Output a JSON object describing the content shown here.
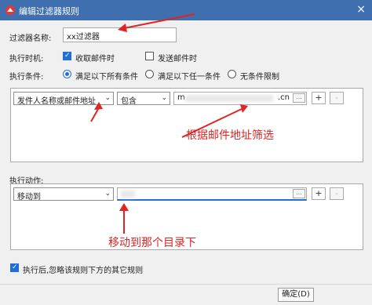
{
  "window": {
    "title": "编辑过滤器规则",
    "close_glyph": "×"
  },
  "form": {
    "name_label": "过滤器名称:",
    "name_value": "xx过滤器",
    "time_label": "执行时机:",
    "time_options": [
      {
        "label": "收取邮件时",
        "checked": true
      },
      {
        "label": "发送邮件时",
        "checked": false
      }
    ],
    "cond_label": "执行条件:",
    "cond_options": [
      {
        "label": "满足以下所有条件",
        "selected": true
      },
      {
        "label": "满足以下任一条件",
        "selected": false
      },
      {
        "label": "无条件限制",
        "selected": false
      }
    ]
  },
  "condition": {
    "field": "发件人名称或邮件地址",
    "operator": "包含",
    "value_prefix": "m",
    "value_suffix": ".cn",
    "ellipsis": "...",
    "add": "+",
    "remove": "-"
  },
  "action": {
    "label": "执行动作:",
    "type": "移动到",
    "ellipsis": "...",
    "add": "+",
    "remove": "-"
  },
  "annotations": {
    "email_hint": "根据邮件地址筛选",
    "folder_hint": "移动到那个目录下"
  },
  "footer": {
    "skip_label": "执行后,忽略该规则下方的其它规则",
    "skip_checked": true,
    "ok": "确定(D)"
  },
  "colors": {
    "annotation": "#e02323",
    "accent": "#1e6fd9",
    "titlebar": "#3f6fae"
  },
  "icons": [
    "app-logo-icon",
    "close-icon",
    "chevron-down-icon",
    "checkbox-icon",
    "radio-icon",
    "red-arrow-icon"
  ]
}
